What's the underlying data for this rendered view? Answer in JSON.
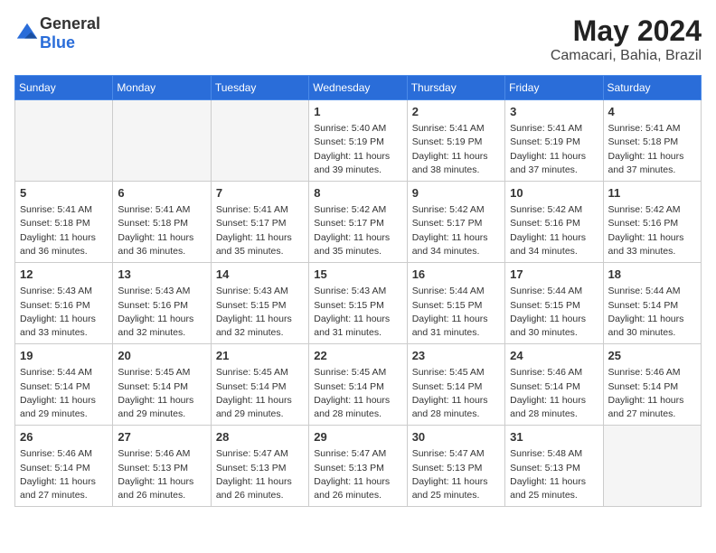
{
  "header": {
    "logo_general": "General",
    "logo_blue": "Blue",
    "month_year": "May 2024",
    "location": "Camacari, Bahia, Brazil"
  },
  "weekdays": [
    "Sunday",
    "Monday",
    "Tuesday",
    "Wednesday",
    "Thursday",
    "Friday",
    "Saturday"
  ],
  "weeks": [
    [
      {
        "day": "",
        "info": ""
      },
      {
        "day": "",
        "info": ""
      },
      {
        "day": "",
        "info": ""
      },
      {
        "day": "1",
        "info": "Sunrise: 5:40 AM\nSunset: 5:19 PM\nDaylight: 11 hours and 39 minutes."
      },
      {
        "day": "2",
        "info": "Sunrise: 5:41 AM\nSunset: 5:19 PM\nDaylight: 11 hours and 38 minutes."
      },
      {
        "day": "3",
        "info": "Sunrise: 5:41 AM\nSunset: 5:19 PM\nDaylight: 11 hours and 37 minutes."
      },
      {
        "day": "4",
        "info": "Sunrise: 5:41 AM\nSunset: 5:18 PM\nDaylight: 11 hours and 37 minutes."
      }
    ],
    [
      {
        "day": "5",
        "info": "Sunrise: 5:41 AM\nSunset: 5:18 PM\nDaylight: 11 hours and 36 minutes."
      },
      {
        "day": "6",
        "info": "Sunrise: 5:41 AM\nSunset: 5:18 PM\nDaylight: 11 hours and 36 minutes."
      },
      {
        "day": "7",
        "info": "Sunrise: 5:41 AM\nSunset: 5:17 PM\nDaylight: 11 hours and 35 minutes."
      },
      {
        "day": "8",
        "info": "Sunrise: 5:42 AM\nSunset: 5:17 PM\nDaylight: 11 hours and 35 minutes."
      },
      {
        "day": "9",
        "info": "Sunrise: 5:42 AM\nSunset: 5:17 PM\nDaylight: 11 hours and 34 minutes."
      },
      {
        "day": "10",
        "info": "Sunrise: 5:42 AM\nSunset: 5:16 PM\nDaylight: 11 hours and 34 minutes."
      },
      {
        "day": "11",
        "info": "Sunrise: 5:42 AM\nSunset: 5:16 PM\nDaylight: 11 hours and 33 minutes."
      }
    ],
    [
      {
        "day": "12",
        "info": "Sunrise: 5:43 AM\nSunset: 5:16 PM\nDaylight: 11 hours and 33 minutes."
      },
      {
        "day": "13",
        "info": "Sunrise: 5:43 AM\nSunset: 5:16 PM\nDaylight: 11 hours and 32 minutes."
      },
      {
        "day": "14",
        "info": "Sunrise: 5:43 AM\nSunset: 5:15 PM\nDaylight: 11 hours and 32 minutes."
      },
      {
        "day": "15",
        "info": "Sunrise: 5:43 AM\nSunset: 5:15 PM\nDaylight: 11 hours and 31 minutes."
      },
      {
        "day": "16",
        "info": "Sunrise: 5:44 AM\nSunset: 5:15 PM\nDaylight: 11 hours and 31 minutes."
      },
      {
        "day": "17",
        "info": "Sunrise: 5:44 AM\nSunset: 5:15 PM\nDaylight: 11 hours and 30 minutes."
      },
      {
        "day": "18",
        "info": "Sunrise: 5:44 AM\nSunset: 5:14 PM\nDaylight: 11 hours and 30 minutes."
      }
    ],
    [
      {
        "day": "19",
        "info": "Sunrise: 5:44 AM\nSunset: 5:14 PM\nDaylight: 11 hours and 29 minutes."
      },
      {
        "day": "20",
        "info": "Sunrise: 5:45 AM\nSunset: 5:14 PM\nDaylight: 11 hours and 29 minutes."
      },
      {
        "day": "21",
        "info": "Sunrise: 5:45 AM\nSunset: 5:14 PM\nDaylight: 11 hours and 29 minutes."
      },
      {
        "day": "22",
        "info": "Sunrise: 5:45 AM\nSunset: 5:14 PM\nDaylight: 11 hours and 28 minutes."
      },
      {
        "day": "23",
        "info": "Sunrise: 5:45 AM\nSunset: 5:14 PM\nDaylight: 11 hours and 28 minutes."
      },
      {
        "day": "24",
        "info": "Sunrise: 5:46 AM\nSunset: 5:14 PM\nDaylight: 11 hours and 28 minutes."
      },
      {
        "day": "25",
        "info": "Sunrise: 5:46 AM\nSunset: 5:14 PM\nDaylight: 11 hours and 27 minutes."
      }
    ],
    [
      {
        "day": "26",
        "info": "Sunrise: 5:46 AM\nSunset: 5:14 PM\nDaylight: 11 hours and 27 minutes."
      },
      {
        "day": "27",
        "info": "Sunrise: 5:46 AM\nSunset: 5:13 PM\nDaylight: 11 hours and 26 minutes."
      },
      {
        "day": "28",
        "info": "Sunrise: 5:47 AM\nSunset: 5:13 PM\nDaylight: 11 hours and 26 minutes."
      },
      {
        "day": "29",
        "info": "Sunrise: 5:47 AM\nSunset: 5:13 PM\nDaylight: 11 hours and 26 minutes."
      },
      {
        "day": "30",
        "info": "Sunrise: 5:47 AM\nSunset: 5:13 PM\nDaylight: 11 hours and 25 minutes."
      },
      {
        "day": "31",
        "info": "Sunrise: 5:48 AM\nSunset: 5:13 PM\nDaylight: 11 hours and 25 minutes."
      },
      {
        "day": "",
        "info": ""
      }
    ]
  ]
}
